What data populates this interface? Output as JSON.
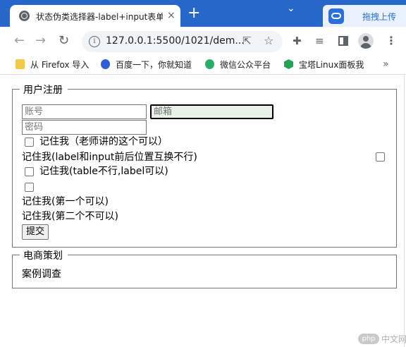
{
  "browser": {
    "tab_title": "状态伪类选择器-label+input表单",
    "tab_close": "×",
    "new_tab": "+",
    "minimize": "⌄",
    "extension_label": "拖拽上传",
    "url": "127.0.0.1:5500/1021/dem...",
    "bookmarks": [
      {
        "label": "从 Firefox 导入",
        "icon": "folder-icon"
      },
      {
        "label": "百度一下，你就知道",
        "icon": "baidu-icon"
      },
      {
        "label": "微信公众平台",
        "icon": "wechat-icon"
      },
      {
        "label": "宝塔Linux面板我",
        "icon": "baota-icon"
      }
    ],
    "bookmarks_more": "»"
  },
  "page": {
    "register": {
      "legend": "用户注册",
      "account_placeholder": "账号",
      "email_placeholder": "邮箱",
      "password_placeholder": "密码",
      "remember_teacher": "记住我（老师讲的这个可以）",
      "remember_swap": "记住我(label和input前后位置互换不行)",
      "remember_table": "记住我(table不行,label可以)",
      "remember_first": "记住我(第一个可以)",
      "remember_second": "记住我(第二个不可以)",
      "submit": "提交"
    },
    "ecommerce": {
      "legend": "电商策划",
      "item": "案例调查"
    }
  },
  "watermark": {
    "logo": "php",
    "text": "中文网"
  },
  "colors": {
    "tabbar": "#2767c9",
    "focus_bg": "#e8f0e8"
  }
}
